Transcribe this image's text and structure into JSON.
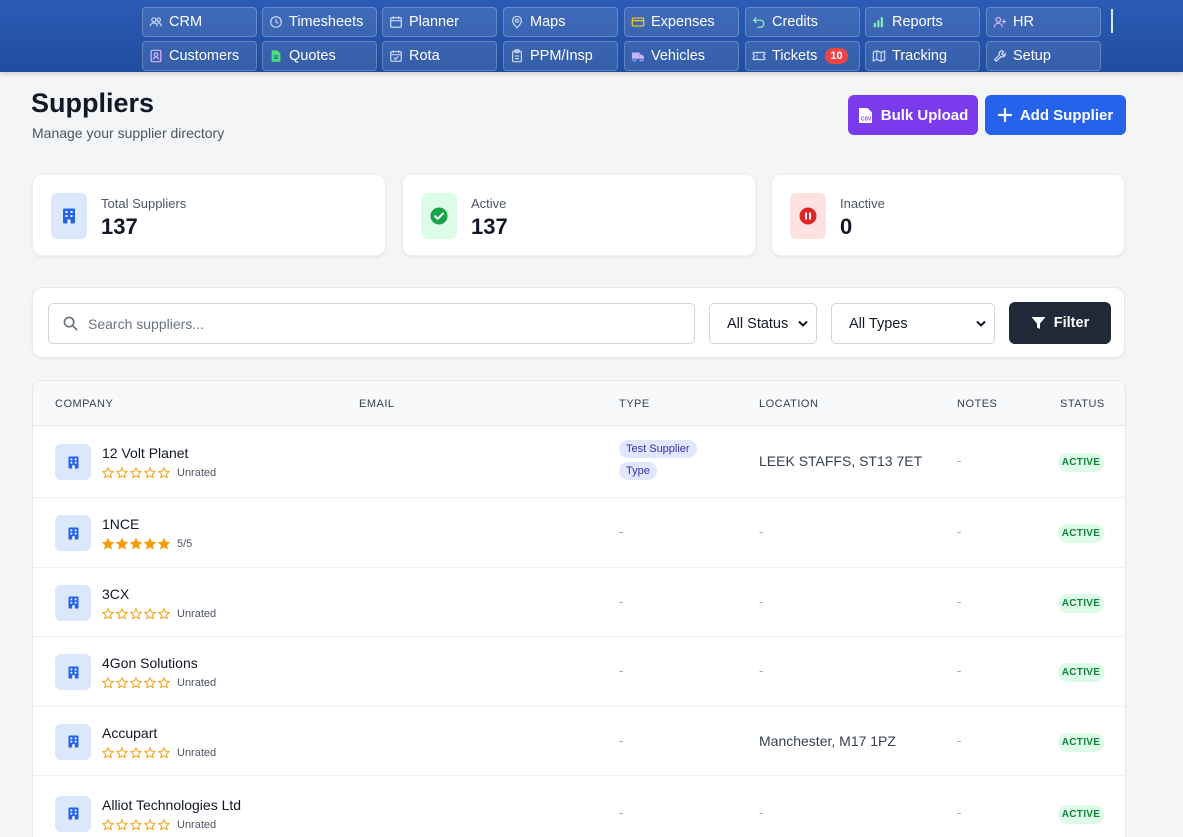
{
  "nav": {
    "row1": [
      {
        "label": "CRM",
        "icon": "users-icon"
      },
      {
        "label": "Timesheets",
        "icon": "clock-icon"
      },
      {
        "label": "Planner",
        "icon": "calendar-icon"
      },
      {
        "label": "Maps",
        "icon": "map-pin-icon"
      },
      {
        "label": "Expenses",
        "icon": "credit-card-icon"
      },
      {
        "label": "Credits",
        "icon": "undo-icon"
      },
      {
        "label": "Reports",
        "icon": "bar-chart-icon"
      },
      {
        "label": "HR",
        "icon": "user-plus-icon"
      }
    ],
    "row2": [
      {
        "label": "Customers",
        "icon": "contact-icon"
      },
      {
        "label": "Quotes",
        "icon": "document-icon"
      },
      {
        "label": "Rota",
        "icon": "calendar-check-icon"
      },
      {
        "label": "PPM/Insp",
        "icon": "clipboard-icon"
      },
      {
        "label": "Vehicles",
        "icon": "truck-icon"
      },
      {
        "label": "Tickets",
        "icon": "ticket-icon",
        "badge": "10"
      },
      {
        "label": "Tracking",
        "icon": "map-icon"
      },
      {
        "label": "Setup",
        "icon": "wrench-icon"
      }
    ]
  },
  "header": {
    "title": "Suppliers",
    "subtitle": "Manage your supplier directory",
    "bulk_upload_label": "Bulk Upload",
    "add_supplier_label": "Add Supplier"
  },
  "stats": {
    "total_label": "Total Suppliers",
    "total_value": "137",
    "active_label": "Active",
    "active_value": "137",
    "inactive_label": "Inactive",
    "inactive_value": "0"
  },
  "filters": {
    "search_placeholder": "Search suppliers...",
    "status_selected": "All Status",
    "types_selected": "All Types",
    "filter_label": "Filter"
  },
  "table": {
    "columns": [
      "COMPANY",
      "EMAIL",
      "TYPE",
      "LOCATION",
      "NOTES",
      "STATUS"
    ],
    "rows": [
      {
        "name": "12 Volt Planet",
        "stars": 0,
        "rating": "Unrated",
        "type": "Test Supplier Type",
        "location": "LEEK STAFFS, ST13 7ET",
        "notes": "-",
        "status": "ACTIVE"
      },
      {
        "name": "1NCE",
        "stars": 5,
        "rating": "5/5",
        "type": "-",
        "location": "-",
        "notes": "-",
        "status": "ACTIVE"
      },
      {
        "name": "3CX",
        "stars": 0,
        "rating": "Unrated",
        "type": "-",
        "location": "-",
        "notes": "-",
        "status": "ACTIVE"
      },
      {
        "name": "4Gon Solutions",
        "stars": 0,
        "rating": "Unrated",
        "type": "-",
        "location": "-",
        "notes": "-",
        "status": "ACTIVE"
      },
      {
        "name": "Accupart",
        "stars": 0,
        "rating": "Unrated",
        "type": "-",
        "location": "Manchester, M17 1PZ",
        "notes": "-",
        "status": "ACTIVE"
      },
      {
        "name": "Alliot Technologies Ltd",
        "stars": 0,
        "rating": "Unrated",
        "type": "-",
        "location": "-",
        "notes": "-",
        "status": "ACTIVE"
      }
    ]
  },
  "colors": {
    "nav_bg": "#1f4d9f",
    "bulk_button": "#7c3aed",
    "add_button": "#2563eb",
    "star": "#f59e0b",
    "active_badge_bg": "#dcfce7",
    "active_badge_text": "#15803d"
  }
}
